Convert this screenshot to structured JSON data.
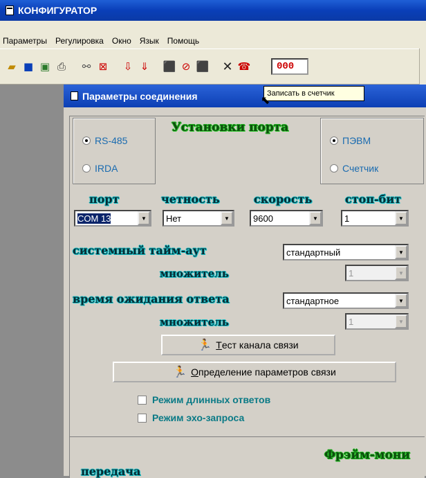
{
  "app": {
    "title": "КОНФИГУРАТОР"
  },
  "menu": {
    "items": [
      "Параметры",
      "Регулировка",
      "Окно",
      "Язык",
      "Помощь"
    ]
  },
  "toolbar": {
    "icons": [
      "open-folder-icon",
      "save-icon",
      "monitor-icon",
      "printer-icon",
      "binoculars-icon",
      "delete-icon",
      "read-down-icon",
      "write-down-icon",
      "read-meter-icon",
      "stop-icon",
      "write-meter-icon",
      "close-icon",
      "phone-icon"
    ],
    "counter_value": "000"
  },
  "tooltip": {
    "text": "Записать в счетчик"
  },
  "dialog": {
    "title": "Параметры соединения",
    "port_settings_label": "Установки порта",
    "interface": {
      "option1": "RS-485",
      "option2": "IRDA",
      "selected": "RS-485"
    },
    "target": {
      "option1": "ПЭВМ",
      "option2": "Счетчик",
      "selected": "ПЭВМ"
    },
    "labels": {
      "port": "порт",
      "parity": "четность",
      "speed": "скорость",
      "stop_bit": "стоп-бит",
      "system_timeout": "системный тайм-аут",
      "multiplier1": "множитель",
      "response_wait": "время ожидания ответа",
      "multiplier2": "множитель"
    },
    "values": {
      "port": "COM 13",
      "parity": "Нет",
      "speed": "9600",
      "stop_bit": "1",
      "system_timeout": "стандартный",
      "multiplier1": "1",
      "response_wait": "стандартное",
      "multiplier2": "1"
    },
    "buttons": {
      "test_channel": "Тест канала связи",
      "test_channel_underline": "Т",
      "test_channel_rest": "ест канала связи",
      "detect_params_underline": "О",
      "detect_params_rest": "пределение параметров связи"
    },
    "checks": {
      "long_responses": "Режим длинных ответов",
      "echo_request": "Режим эхо-запроса"
    },
    "frame_monitor_label": "Фрэйм-мони",
    "transmit_label": "передача"
  },
  "colors": {
    "titlebar": "#0a3fb8",
    "accent_cyan": "#16c1c9",
    "accent_green": "#24c024",
    "counter_red": "#cc0000"
  }
}
